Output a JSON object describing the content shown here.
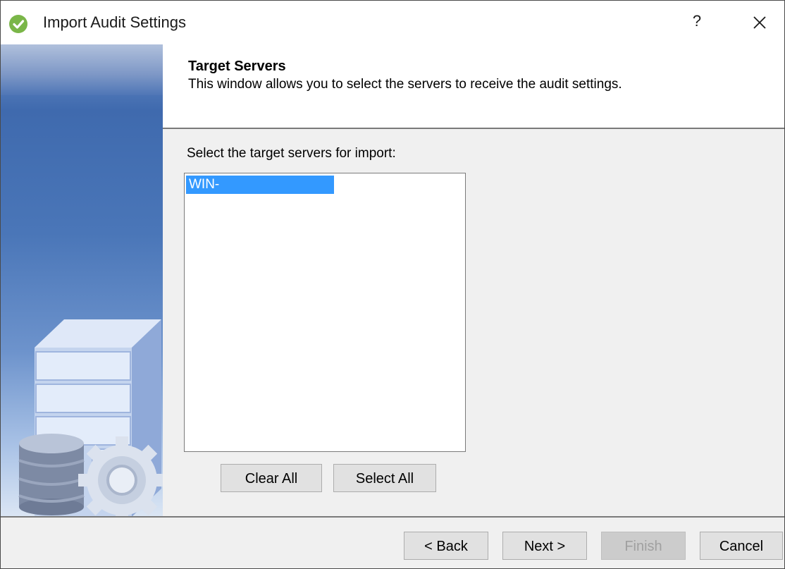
{
  "window": {
    "title": "Import Audit Settings",
    "help_label": "?",
    "icon": "green-check-icon"
  },
  "header": {
    "title": "Target Servers",
    "subtitle": "This window allows you to select the servers to receive the audit settings."
  },
  "content": {
    "select_label": "Select the target servers for import:",
    "servers": [
      "WIN-"
    ],
    "selected_server": "WIN-",
    "clear_all_label": "Clear All",
    "select_all_label": "Select All"
  },
  "footer": {
    "back_label": "< Back",
    "next_label": "Next >",
    "finish_label": "Finish",
    "cancel_label": "Cancel"
  },
  "colors": {
    "selection": "#3399ff",
    "banner": "#4a76b8",
    "app_icon": "#7ab648"
  }
}
